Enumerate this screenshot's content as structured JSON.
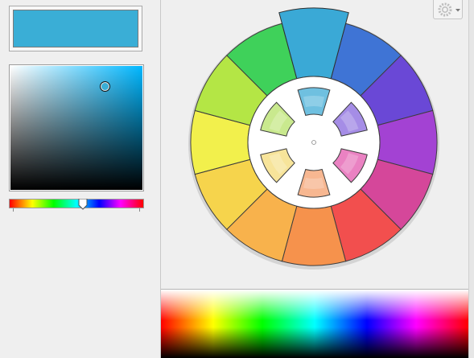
{
  "colors": {
    "current": "#3aaed6",
    "sv_base": "#00b7ff",
    "panel_bg": "#efefef"
  },
  "current_color_swatch": {
    "color": "#3aaed6"
  },
  "saturation_value_picker": {
    "cursor_saturation": 0.72,
    "cursor_value": 0.87
  },
  "hue_slider": {
    "value": 0.55
  },
  "color_wheel": {
    "selected_index": 0,
    "outer_segments": [
      "#3aa9d6",
      "#3f74d5",
      "#6a48d6",
      "#a342d3",
      "#d5479a",
      "#f24f4e",
      "#f6924c",
      "#f8b24c",
      "#f6d44c",
      "#f2f04c",
      "#b4e645",
      "#3fd15a"
    ],
    "inner_segments": [
      "#6fc0e0",
      "#a58de6",
      "#ea82c2",
      "#f7b791",
      "#f7e49a",
      "#c9e98e"
    ]
  },
  "toolbar": {
    "icon": "gear-icon",
    "dropdown_icon": "chevron-down-icon"
  }
}
